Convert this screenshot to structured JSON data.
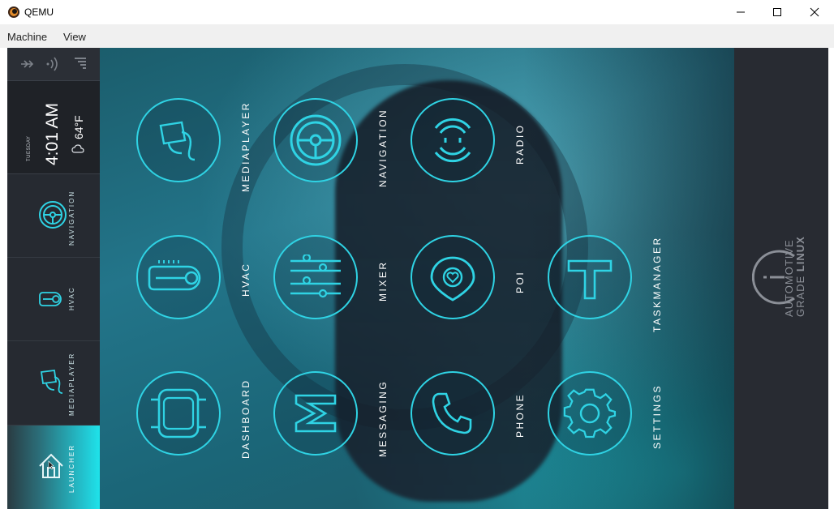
{
  "window": {
    "title": "QEMU",
    "controls": [
      "minimize-icon",
      "maximize-icon",
      "close-icon"
    ]
  },
  "menu": {
    "items": [
      "Machine",
      "View"
    ]
  },
  "sidebar": {
    "status_icons": [
      "bluetooth-icon",
      "wifi-icon",
      "signal-icon"
    ],
    "clock": {
      "day": "TUESDAY",
      "time": "4:01 AM",
      "temperature": "64°F"
    },
    "items": [
      {
        "label": "NAVIGATION",
        "icon": "steering-wheel-icon"
      },
      {
        "label": "HVAC",
        "icon": "thermometer-icon"
      },
      {
        "label": "MEDIAPLAYER",
        "icon": "music-note-icon"
      },
      {
        "label": "LAUNCHER",
        "icon": "home-icon",
        "active": true
      }
    ]
  },
  "apps": [
    {
      "label": "MEDIAPLAYER",
      "icon": "music-note-icon"
    },
    {
      "label": "NAVIGATION",
      "icon": "steering-wheel-icon"
    },
    {
      "label": "RADIO",
      "icon": "radio-waves-icon"
    },
    {
      "label": "HVAC",
      "icon": "thermometer-icon"
    },
    {
      "label": "MIXER",
      "icon": "mixer-sliders-icon"
    },
    {
      "label": "POI",
      "icon": "location-pin-icon"
    },
    {
      "label": "TASKMANAGER",
      "icon": "taskmanager-icon"
    },
    {
      "label": "DASHBOARD",
      "icon": "car-dashboard-icon"
    },
    {
      "label": "MESSAGING",
      "icon": "messaging-icon"
    },
    {
      "label": "PHONE",
      "icon": "phone-icon"
    },
    {
      "label": "SETTINGS",
      "icon": "gear-icon"
    }
  ],
  "branding": {
    "line1": "AUTOMOTIVE",
    "line2_light": "GRADE ",
    "line2_bold": "LINUX"
  },
  "colors": {
    "accent": "#2fd3e4",
    "sidebar": "#262a31",
    "launcher_active": "#1fe3ea"
  }
}
